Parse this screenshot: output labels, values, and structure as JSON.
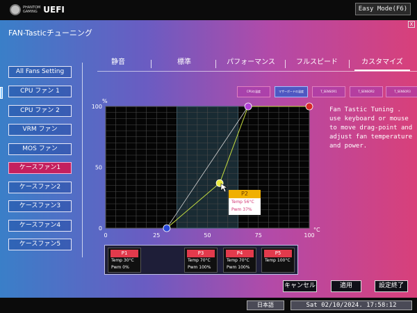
{
  "header": {
    "logo_top": "PHANTOM",
    "logo_bottom": "GAMING",
    "logo_main": "UEFI",
    "easy_mode": "Easy Mode(F6)",
    "close": "X"
  },
  "page_title": "FAN-Tasticチューニング",
  "sidebar": {
    "items": [
      {
        "label": "All Fans Setting",
        "active": false
      },
      {
        "label": "CPU ファン 1",
        "active": false
      },
      {
        "label": "CPU ファン 2",
        "active": false
      },
      {
        "label": "VRM ファン",
        "active": false
      },
      {
        "label": "MOS ファン",
        "active": false
      },
      {
        "label": "ケースファン1",
        "active": true
      },
      {
        "label": "ケースファン2",
        "active": false
      },
      {
        "label": "ケースファン3",
        "active": false
      },
      {
        "label": "ケースファン4",
        "active": false
      },
      {
        "label": "ケースファン5",
        "active": false
      }
    ]
  },
  "tabs": [
    {
      "label": "静音",
      "active": false
    },
    {
      "label": "標準",
      "active": false
    },
    {
      "label": "パフォーマンス",
      "active": false
    },
    {
      "label": "フルスピード",
      "active": false
    },
    {
      "label": "カスタマイズ",
      "active": true
    }
  ],
  "sensors": [
    {
      "label": "CPUの温度",
      "active": false
    },
    {
      "label": "マザーボードの温度",
      "active": true
    },
    {
      "label": "T_SENSOR1",
      "active": false
    },
    {
      "label": "T_SENSOR2",
      "active": false
    },
    {
      "label": "T_SENSOR3",
      "active": false
    }
  ],
  "chart_data": {
    "type": "line",
    "xlabel": "°C",
    "ylabel": "%",
    "x_ticks": [
      0,
      25,
      50,
      75,
      100
    ],
    "y_ticks": [
      0,
      50,
      100
    ],
    "xlim": [
      0,
      100
    ],
    "ylim": [
      0,
      100
    ],
    "grid": true,
    "highlight_range_x": [
      35,
      65
    ],
    "colors": {
      "curve": "#c8e040",
      "reference": "#d8d8d8",
      "p1": "#2848d8",
      "p2": "#e8e840",
      "p3": "#b040d8",
      "p4": "#d82828"
    },
    "points": [
      {
        "name": "P1",
        "x": 30,
        "y": 0
      },
      {
        "name": "P2",
        "x": 56,
        "y": 37
      },
      {
        "name": "P3",
        "x": 70,
        "y": 100
      },
      {
        "name": "P4",
        "x": 100,
        "y": 100
      }
    ],
    "reference_line": [
      {
        "x": 30,
        "y": 0
      },
      {
        "x": 70,
        "y": 100
      }
    ]
  },
  "tooltip": {
    "title": "P2",
    "temp": "Temp 56°C",
    "pwm": "Pwm  37%"
  },
  "description": "Fan Tastic Tuning . use keyboard or mouse to move drag-point and adjust fan temperature and power.",
  "point_table": [
    {
      "name": "P1",
      "temp": "Temp 30°C",
      "pwm": "Pwm  0%"
    },
    {
      "name": "P3",
      "temp": "Temp 70°C",
      "pwm": "Pwm  100%"
    },
    {
      "name": "P4",
      "temp": "Temp 70°C",
      "pwm": "Pwm  100%"
    },
    {
      "name": "P5",
      "temp": "Temp 100°C",
      "pwm": ""
    }
  ],
  "actions": {
    "cancel": "キャンセル",
    "apply": "適用",
    "done": "設定終了"
  },
  "footer": {
    "language": "日本語",
    "datetime": "Sat 02/10/2024. 17:58:12"
  }
}
